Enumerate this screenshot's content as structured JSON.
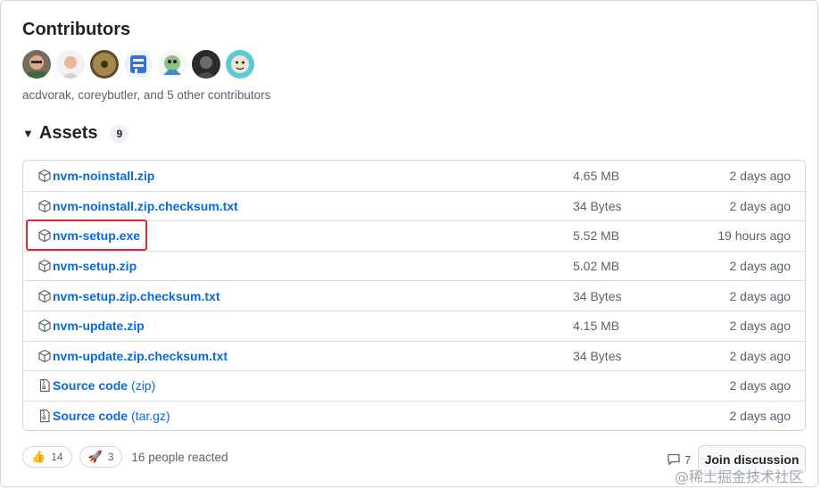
{
  "contributors": {
    "heading": "Contributors",
    "avatars": [
      "acdvorak",
      "coreybutler",
      "contributor-3",
      "contributor-4",
      "contributor-5",
      "contributor-6",
      "contributor-7"
    ],
    "summary": "acdvorak, coreybutler, and 5 other contributors"
  },
  "assets": {
    "title": "Assets",
    "count": "9",
    "rows": [
      {
        "name": "nvm-noinstall.zip",
        "suffix": "",
        "size": "4.65 MB",
        "date": "2 days ago",
        "icon": "package-icon"
      },
      {
        "name": "nvm-noinstall.zip.checksum.txt",
        "suffix": "",
        "size": "34 Bytes",
        "date": "2 days ago",
        "icon": "package-icon"
      },
      {
        "name": "nvm-setup.exe",
        "suffix": "",
        "size": "5.52 MB",
        "date": "19 hours ago",
        "icon": "package-icon"
      },
      {
        "name": "nvm-setup.zip",
        "suffix": "",
        "size": "5.02 MB",
        "date": "2 days ago",
        "icon": "package-icon"
      },
      {
        "name": "nvm-setup.zip.checksum.txt",
        "suffix": "",
        "size": "34 Bytes",
        "date": "2 days ago",
        "icon": "package-icon"
      },
      {
        "name": "nvm-update.zip",
        "suffix": "",
        "size": "4.15 MB",
        "date": "2 days ago",
        "icon": "package-icon"
      },
      {
        "name": "nvm-update.zip.checksum.txt",
        "suffix": "",
        "size": "34 Bytes",
        "date": "2 days ago",
        "icon": "package-icon"
      },
      {
        "name": "Source code",
        "suffix": "(zip)",
        "size": "",
        "date": "2 days ago",
        "icon": "file-zip-icon"
      },
      {
        "name": "Source code",
        "suffix": "(tar.gz)",
        "size": "",
        "date": "2 days ago",
        "icon": "file-zip-icon"
      }
    ]
  },
  "reactions": {
    "thumbs_up": {
      "emoji": "👍",
      "count": "14"
    },
    "rocket": {
      "emoji": "🚀",
      "count": "3"
    },
    "summary": "16 people reacted"
  },
  "discussion": {
    "count": "7",
    "button_label": "Join discussion"
  },
  "watermark": "@稀土掘金技术社区",
  "colors": {
    "link": "#0969da",
    "highlight": "#e5262a",
    "muted": "#59636e"
  }
}
